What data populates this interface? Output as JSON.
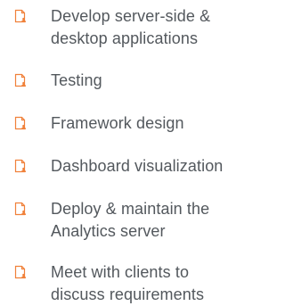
{
  "accent_color": "#f0813a",
  "text_color": "#53585d",
  "icon_name": "document-user-icon",
  "items": [
    {
      "line1": "Develop server-side &",
      "line2": "desktop applications"
    },
    {
      "line1": "Testing",
      "line2": ""
    },
    {
      "line1": "Framework design",
      "line2": ""
    },
    {
      "line1": "Dashboard visualization",
      "line2": ""
    },
    {
      "line1": "Deploy & maintain the",
      "line2": "Analytics server"
    },
    {
      "line1": "Meet with clients to",
      "line2": "discuss requirements"
    }
  ]
}
